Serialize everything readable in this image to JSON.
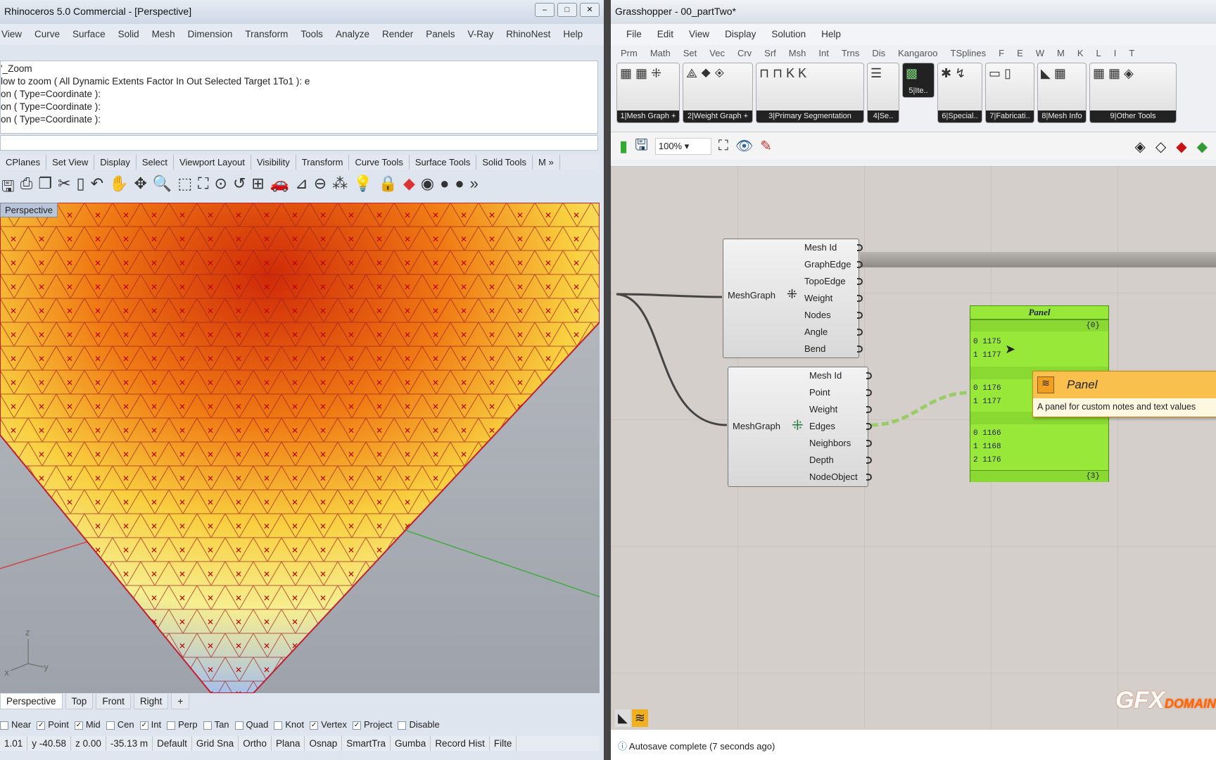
{
  "rhino": {
    "title": "Rhinoceros 5.0 Commercial - [Perspective]",
    "menu": [
      "View",
      "Curve",
      "Surface",
      "Solid",
      "Mesh",
      "Dimension",
      "Transform",
      "Tools",
      "Analyze",
      "Render",
      "Panels",
      "V-Ray",
      "RhinoNest",
      "Help"
    ],
    "command_history": [
      "'_Zoom",
      "low to zoom ( All  Dynamic  Extents  Factor  In  Out  Selected  Target  1To1 ): e",
      "on ( Type=Coordinate ):",
      "on ( Type=Coordinate ):",
      "on ( Type=Coordinate ):"
    ],
    "toolbar_tabs": [
      "CPlanes",
      "Set View",
      "Display",
      "Select",
      "Viewport Layout",
      "Visibility",
      "Transform",
      "Curve Tools",
      "Surface Tools",
      "Solid Tools",
      "M »"
    ],
    "viewport_label": "Perspective",
    "viewport_tabs": [
      "Perspective",
      "Top",
      "Front",
      "Right",
      "+"
    ],
    "osnaps": [
      {
        "label": "Near",
        "checked": false
      },
      {
        "label": "Point",
        "checked": true
      },
      {
        "label": "Mid",
        "checked": true
      },
      {
        "label": "Cen",
        "checked": false
      },
      {
        "label": "Int",
        "checked": true
      },
      {
        "label": "Perp",
        "checked": false
      },
      {
        "label": "Tan",
        "checked": false
      },
      {
        "label": "Quad",
        "checked": false
      },
      {
        "label": "Knot",
        "checked": false
      },
      {
        "label": "Vertex",
        "checked": true
      },
      {
        "label": "Project",
        "checked": true
      },
      {
        "label": "Disable",
        "checked": false
      }
    ],
    "status": [
      "1.01",
      "y -40.58",
      "z 0.00",
      "-35.13 m",
      "Default",
      "Grid Sna",
      "Ortho",
      "Plana",
      "Osnap",
      "SmartTra",
      "Gumba",
      "Record Hist",
      "Filte"
    ],
    "axes": {
      "z": "z",
      "x": "x",
      "y": "y"
    }
  },
  "gh": {
    "title": "Grasshopper - 00_partTwo*",
    "menu": [
      "File",
      "Edit",
      "View",
      "Display",
      "Solution",
      "Help"
    ],
    "component_tabs": [
      "Prm",
      "Math",
      "Set",
      "Vec",
      "Crv",
      "Srf",
      "Msh",
      "Int",
      "Trns",
      "Dis",
      "Kangaroo",
      "TSplines",
      "F",
      "E",
      "W",
      "M",
      "K",
      "L",
      "I",
      "T"
    ],
    "groups": [
      "1|Mesh Graph +",
      "2|Weight Graph +",
      "3|Primary Segmentation",
      "4|Se..",
      "5|Ite..",
      "6|Special..",
      "7|Fabricati..",
      "8|Mesh Info",
      "9|Other Tools"
    ],
    "zoom": "100%",
    "node1": {
      "name": "MeshGraph",
      "outputs": [
        "Mesh Id",
        "GraphEdge",
        "TopoEdge",
        "Weight",
        "Nodes",
        "Angle",
        "Bend"
      ]
    },
    "node2": {
      "name": "MeshGraph",
      "outputs": [
        "Mesh Id",
        "Point",
        "Weight",
        "Edges",
        "Neighbors",
        "Depth",
        "NodeObject"
      ]
    },
    "panel": {
      "title": "Panel",
      "branch0": "{0}",
      "lines0": [
        "0 1175",
        "1 1177"
      ],
      "lines1": [
        "0 1176",
        "1 1177"
      ],
      "lines2": [
        "0 1166",
        "1 1168",
        "2 1176"
      ],
      "branch_last": "{3}"
    },
    "tooltip": {
      "title": "Panel",
      "desc": "A panel for custom notes and text values"
    },
    "status": "Autosave complete (7 seconds ago)",
    "watermark": "GFXDOMAIN FORUM"
  }
}
